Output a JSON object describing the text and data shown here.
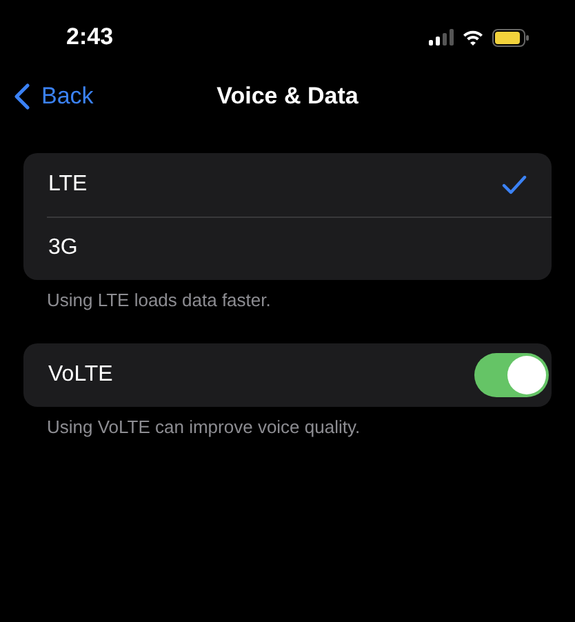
{
  "status_bar": {
    "time": "2:43"
  },
  "nav": {
    "back": "Back",
    "title": "Voice & Data"
  },
  "network_options": [
    {
      "label": "LTE",
      "selected": true
    },
    {
      "label": "3G",
      "selected": false
    }
  ],
  "network_footer": "Using LTE loads data faster.",
  "volte": {
    "label": "VoLTE",
    "on": true
  },
  "volte_footer": "Using VoLTE can improve voice quality."
}
